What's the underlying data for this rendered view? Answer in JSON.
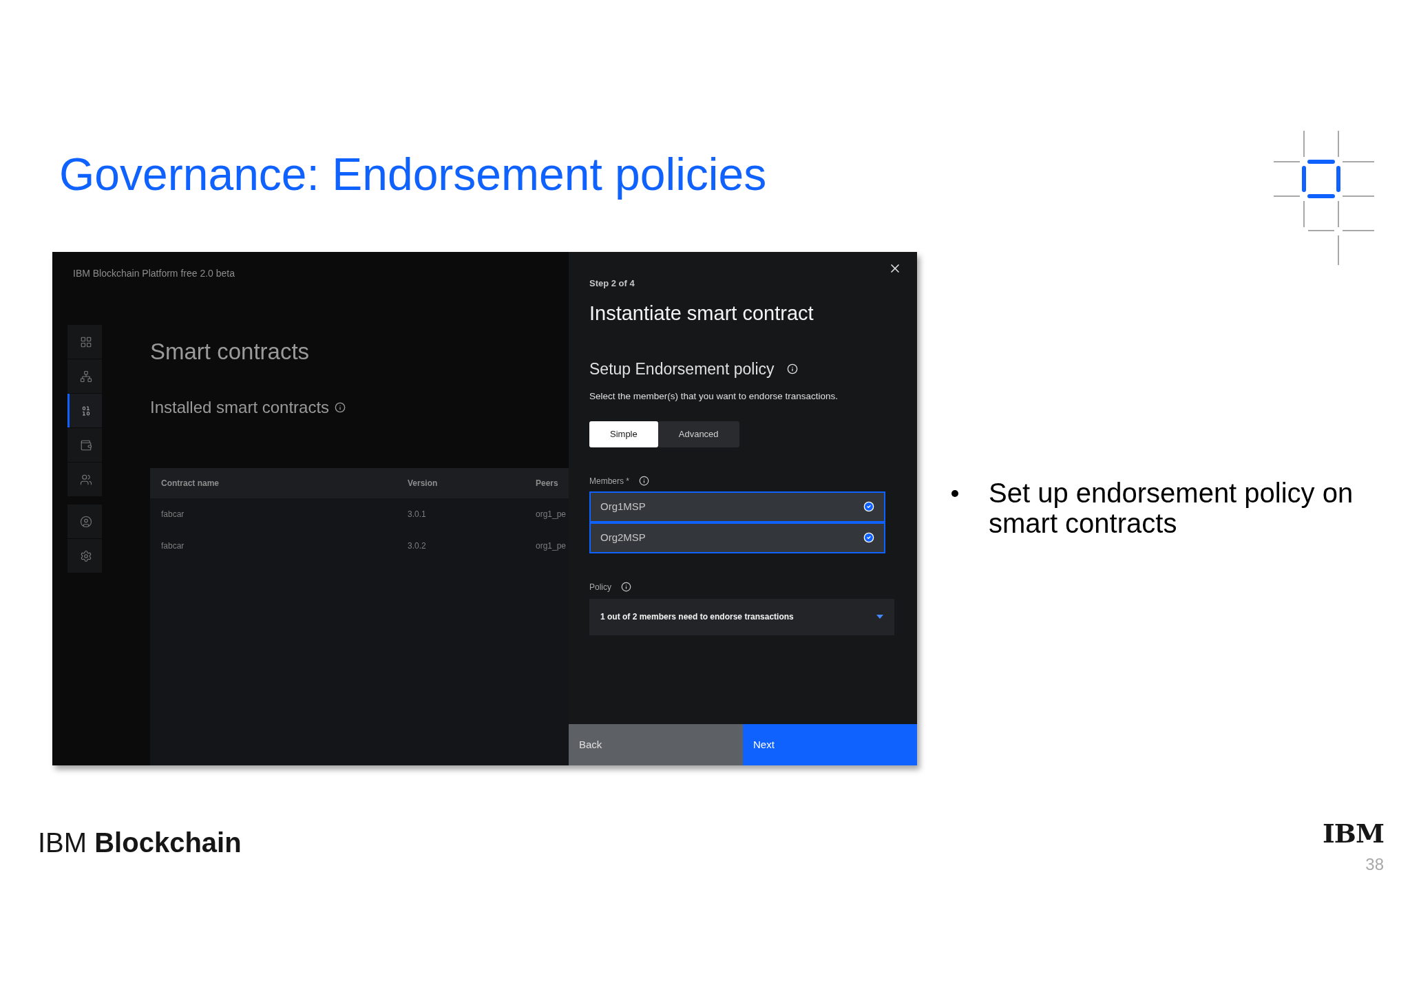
{
  "slide": {
    "title": "Governance: Endorsement policies",
    "bullets": [
      "Set up endorsement policy on smart contracts"
    ],
    "footer_brand": "IBM **Blockchain**",
    "logo_text": "IBM",
    "page_number": "38"
  },
  "app": {
    "header": "IBM Blockchain Platform free 2.0 beta",
    "sidebar": {
      "groups": [
        [
          {
            "kind": "grid",
            "selected": false
          },
          {
            "kind": "network",
            "selected": false
          },
          {
            "kind": "contracts",
            "selected": true
          },
          {
            "kind": "wallet",
            "selected": false
          },
          {
            "kind": "users",
            "selected": false
          }
        ],
        [
          {
            "kind": "profile",
            "selected": false
          },
          {
            "kind": "settings",
            "selected": false
          }
        ]
      ]
    },
    "page_title": "Smart contracts",
    "section_title": "Installed smart contracts",
    "table": {
      "columns": [
        "Contract name",
        "Version",
        "Peers"
      ],
      "rows": [
        [
          "fabcar",
          "3.0.1",
          "org1_pe"
        ],
        [
          "fabcar",
          "3.0.2",
          "org1_pe"
        ]
      ]
    }
  },
  "panel": {
    "step": "Step 2 of 4",
    "title": "Instantiate smart contract",
    "section": "Setup Endorsement policy",
    "description": "Select the member(s) that you want to endorse transactions.",
    "modes": [
      {
        "label": "Simple",
        "selected": true
      },
      {
        "label": "Advanced",
        "selected": false
      }
    ],
    "members_label": "Members *",
    "members": [
      {
        "name": "Org1MSP",
        "checked": true
      },
      {
        "name": "Org2MSP",
        "checked": true
      }
    ],
    "policy_label": "Policy",
    "policy_value": "1 out of 2 members need to endorse transactions",
    "buttons": [
      {
        "label": "Back",
        "kind": "secondary"
      },
      {
        "label": "Next",
        "kind": "primary"
      }
    ]
  }
}
